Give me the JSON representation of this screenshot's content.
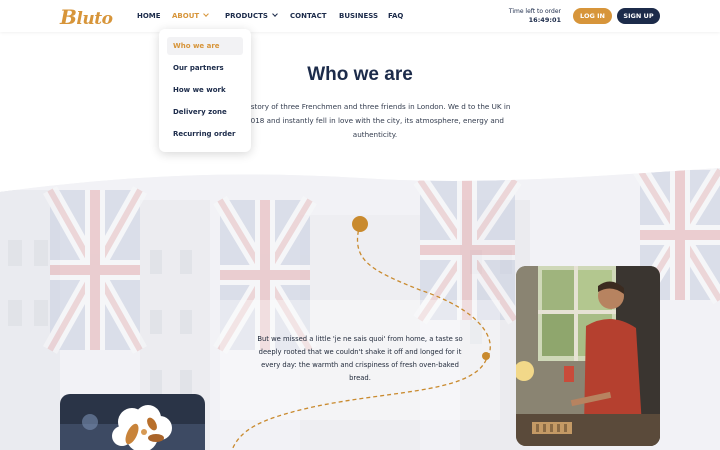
{
  "brand": {
    "logo_text": "Bluto",
    "accent": "#d7953a",
    "navy": "#1c2b4a"
  },
  "nav": {
    "items": [
      {
        "label": "HOME"
      },
      {
        "label": "ABOUT",
        "active": true,
        "has_dropdown": true
      },
      {
        "label": "PRODUCTS",
        "has_dropdown": true
      },
      {
        "label": "CONTACT"
      },
      {
        "label": "BUSINESS"
      },
      {
        "label": "FAQ"
      }
    ],
    "timer_label": "Time left to order",
    "timer_value": "16:49:01",
    "login_label": "LOG IN",
    "signup_label": "SIGN UP"
  },
  "about_menu": {
    "items": [
      {
        "label": "Who we are",
        "active": true
      },
      {
        "label": "Our partners"
      },
      {
        "label": "How we work"
      },
      {
        "label": "Delivery zone"
      },
      {
        "label": "Recurring order"
      }
    ]
  },
  "hero": {
    "title": "Who we are",
    "intro": "he story of three Frenchmen and three friends in London. We d to the UK in 2018 and instantly fell in love with the city, its atmosphere, energy and authenticity."
  },
  "story": {
    "text": "But we missed a little 'je ne sais quoi' from home, a taste so deeply rooted that we couldn't shake it off and longed for it every day: the warmth and crispiness of fresh oven-baked bread."
  }
}
